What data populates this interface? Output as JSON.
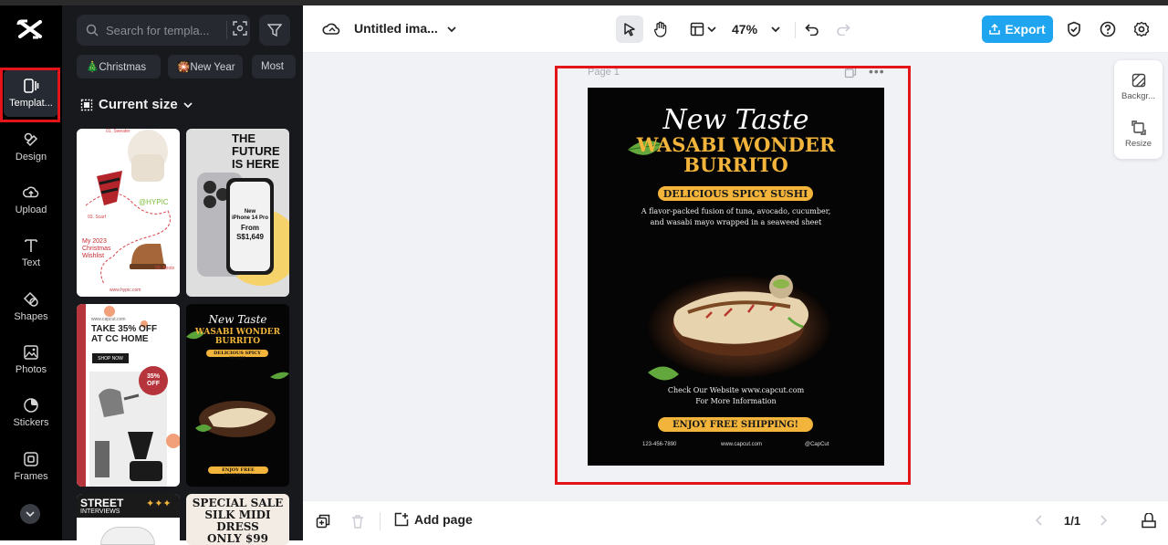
{
  "left_rail": {
    "items": [
      {
        "label": "Templat...",
        "icon": "template-icon"
      },
      {
        "label": "Design",
        "icon": "design-icon"
      },
      {
        "label": "Upload",
        "icon": "upload-icon"
      },
      {
        "label": "Text",
        "icon": "text-icon"
      },
      {
        "label": "Shapes",
        "icon": "shapes-icon"
      },
      {
        "label": "Photos",
        "icon": "photos-icon"
      },
      {
        "label": "Stickers",
        "icon": "stickers-icon"
      },
      {
        "label": "Frames",
        "icon": "frames-icon"
      }
    ]
  },
  "templates_panel": {
    "search_placeholder": "Search for templa...",
    "chips": [
      "🎄Christmas",
      "🎇New Year",
      "Most"
    ],
    "size_label": "Current size",
    "thumbs": {
      "t1": {
        "tag1": "01. Sweater",
        "handle": "@HYPIC",
        "tag2": "03. Scarf",
        "wishlist": "My 2023 Christmas Wishlist",
        "tag3": "03. Boots",
        "site": "www.hypic.com"
      },
      "t2": {
        "headline1": "THE",
        "headline2": "FUTURE",
        "headline3": "IS HERE",
        "product1": "New",
        "product2": "iPhone 14 Pro",
        "from": "From",
        "price": "S$1,649"
      },
      "t3": {
        "site": "www.capcut.com",
        "headline1": "TAKE 35% OFF",
        "headline2": "AT CC HOME",
        "button": "SHOP NOW",
        "badge1": "35%",
        "badge2": "OFF"
      },
      "t4": {
        "script": "New Taste",
        "line1": "WASABI WONDER",
        "line2": "BURRITO",
        "banner": "DELICIOUS SPICY SUSHI",
        "cta": "ENJOY FREE SHIPPING!"
      },
      "t5": {
        "line1": "STREET",
        "line2": "INTERVIEWS"
      },
      "t6": {
        "line1": "SPECIAL SALE",
        "line2": "SILK MIDI DRESS",
        "line3": "ONLY $99"
      }
    }
  },
  "topbar": {
    "title": "Untitled ima...",
    "zoom": "47%",
    "export_label": "Export"
  },
  "canvas": {
    "page_label": "Page 1"
  },
  "poster": {
    "script": "New Taste",
    "line1": "WASABI WONDER",
    "line2": "BURRITO",
    "banner": "DELICIOUS SPICY SUSHI",
    "desc1": "A flavor-packed fusion of tuna, avocado, cucumber,",
    "desc2": "and wasabi mayo wrapped in a seaweed sheet",
    "website1": "Check Our Website www.capcut.com",
    "website2": "For More Information",
    "cta": "ENJOY FREE SHIPPING!",
    "footer_phone": "123-456-7890",
    "footer_site": "www.capcut.com",
    "footer_handle": "@CapCut"
  },
  "side_tools": {
    "background_label": "Backgr...",
    "resize_label": "Resize"
  },
  "bottombar": {
    "add_page_label": "Add page",
    "pager": "1/1"
  },
  "colors": {
    "accent": "#1fa5f0",
    "highlight": "#e3151a",
    "poster_gold": "#f2b43a"
  }
}
